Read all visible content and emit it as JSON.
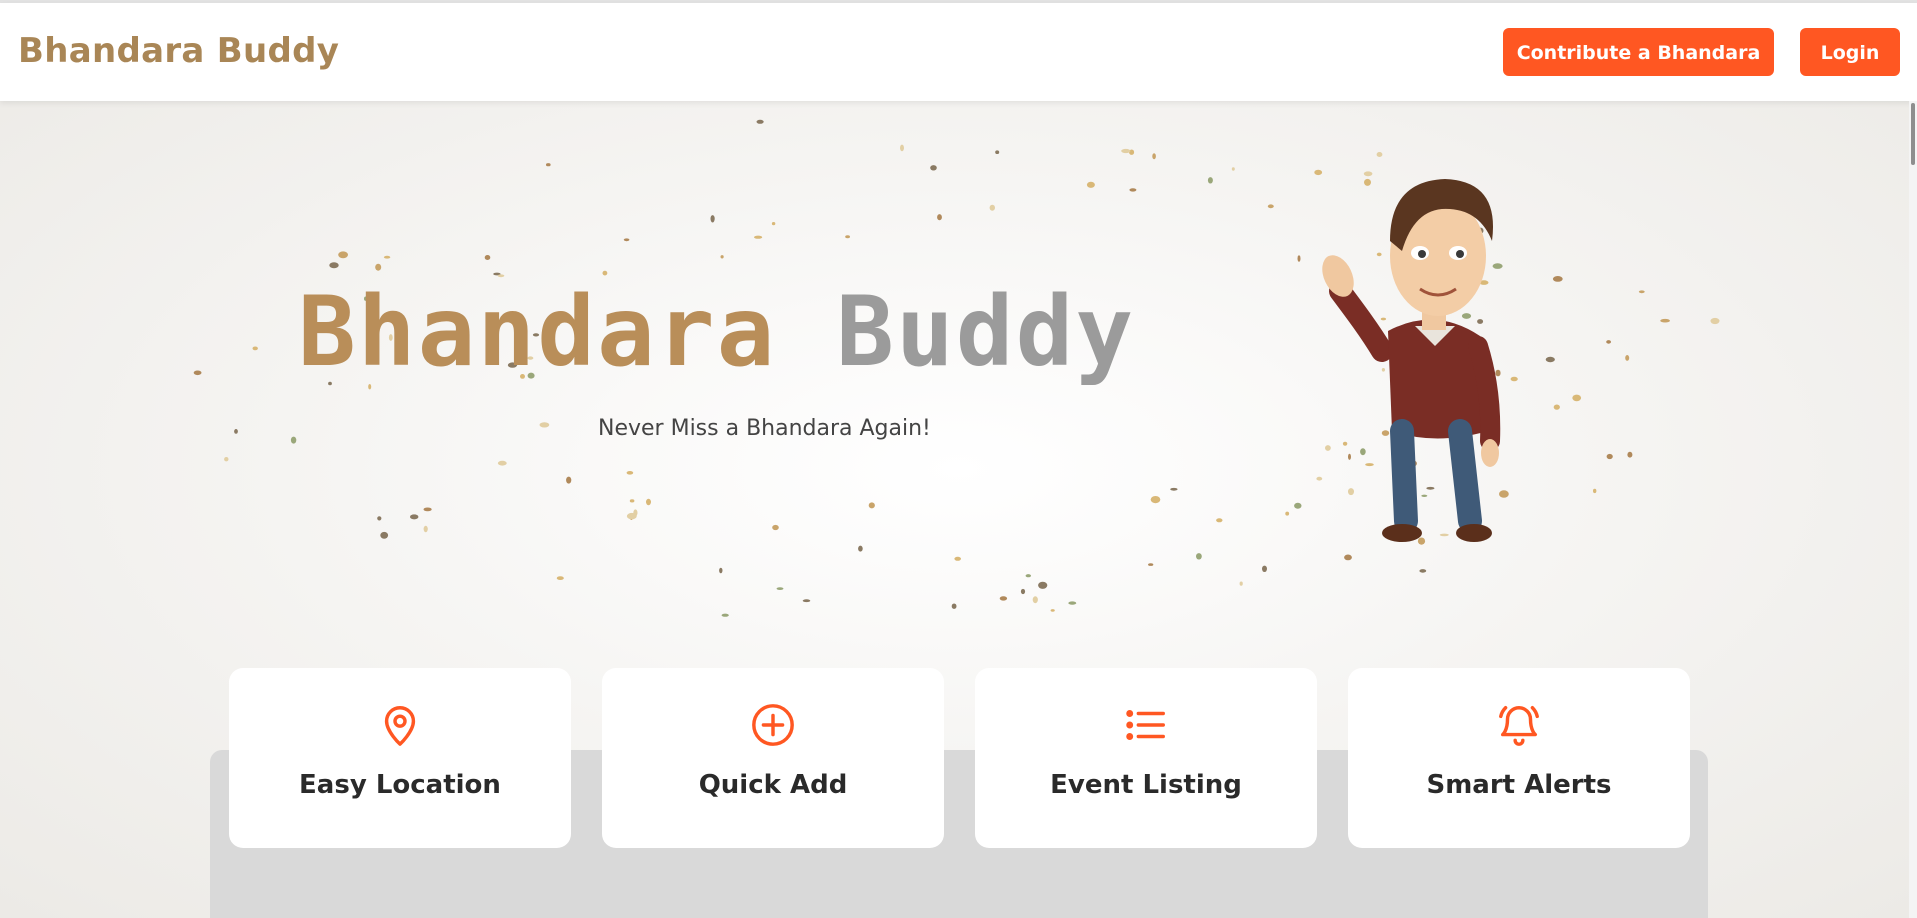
{
  "navbar": {
    "brand": "Bhandara Buddy",
    "contribute_label": "Contribute a Bhandara",
    "login_label": "Login"
  },
  "hero": {
    "title_part1": "Bhandara",
    "title_part2": "Buddy",
    "tagline": "Never Miss a Bhandara Again!"
  },
  "features": [
    {
      "title": "Easy Location",
      "icon": "map-pin-icon"
    },
    {
      "title": "Quick Add",
      "icon": "plus-circle-icon"
    },
    {
      "title": "Event Listing",
      "icon": "list-icon"
    },
    {
      "title": "Smart Alerts",
      "icon": "bell-icon"
    }
  ],
  "colors": {
    "accent": "#ff5722",
    "brand_gold": "#b98e59",
    "brand_grey": "#9b9b9b"
  }
}
